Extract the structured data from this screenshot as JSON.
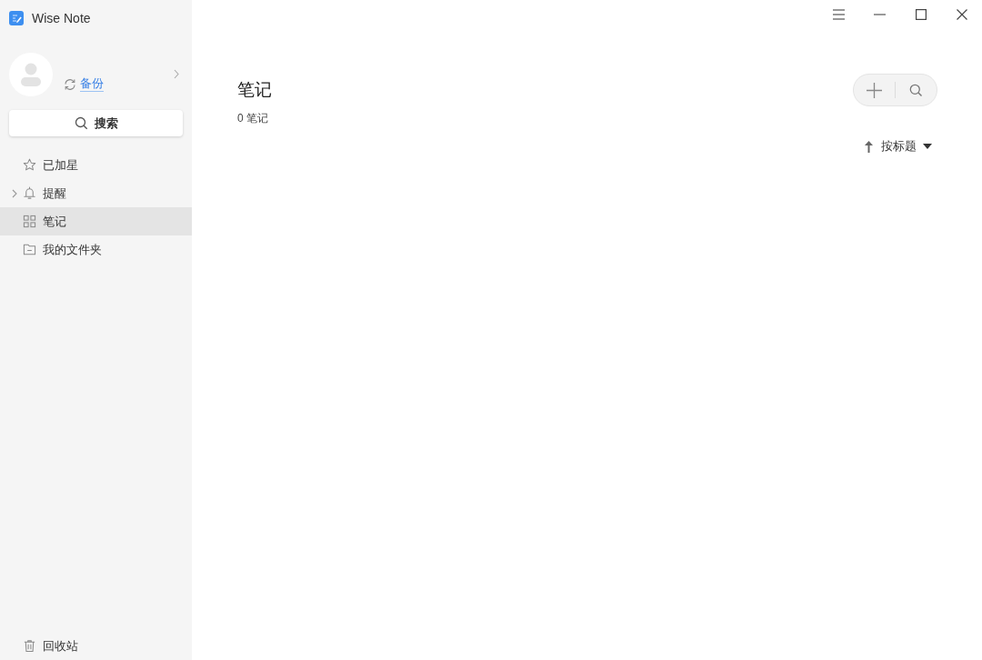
{
  "app": {
    "title": "Wise Note"
  },
  "account": {
    "backup_label": "备份"
  },
  "search_button": {
    "label": "搜索"
  },
  "nav": [
    {
      "kind": "starred",
      "label": "已加星",
      "selected": false
    },
    {
      "kind": "reminders",
      "label": "提醒",
      "selected": false,
      "expanded": false
    },
    {
      "kind": "notes",
      "label": "笔记",
      "selected": true
    },
    {
      "kind": "folders",
      "label": "我的文件夹",
      "selected": false
    }
  ],
  "trash": {
    "label": "回收站"
  },
  "main": {
    "title": "笔记",
    "count": "0 笔记",
    "sort": {
      "label": "按标题",
      "ascending": true
    }
  }
}
